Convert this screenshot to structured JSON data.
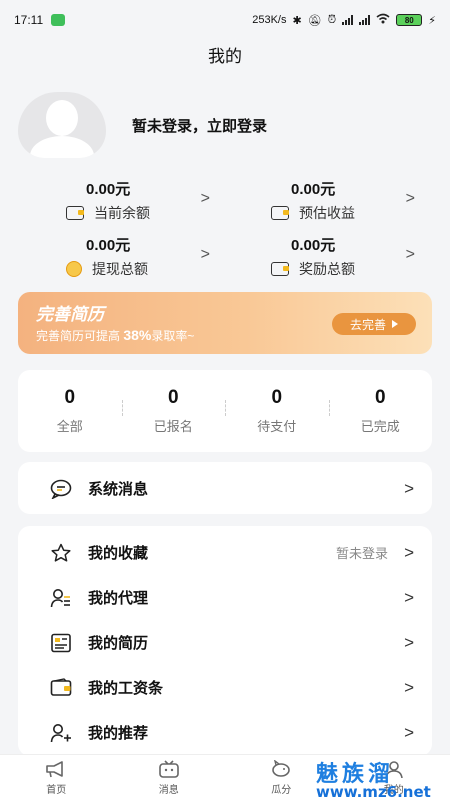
{
  "status_bar": {
    "time": "17:11",
    "network_speed": "253K/s",
    "battery": "80"
  },
  "header": {
    "title": "我的"
  },
  "profile": {
    "login_text": "暂未登录，立即登录"
  },
  "stats": [
    {
      "value": "0.00元",
      "label": "当前余额",
      "icon": "wallet-icon"
    },
    {
      "value": "0.00元",
      "label": "预估收益",
      "icon": "coin-stack-icon"
    },
    {
      "value": "0.00元",
      "label": "提现总额",
      "icon": "yuan-coin-icon"
    },
    {
      "value": "0.00元",
      "label": "奖励总额",
      "icon": "reward-icon"
    }
  ],
  "resume_banner": {
    "title": "完善简历",
    "subtitle_prefix": "完善简历可提高",
    "subtitle_percent": "38%",
    "subtitle_suffix": "录取率~",
    "button_label": "去完善"
  },
  "orders": [
    {
      "count": "0",
      "label": "全部"
    },
    {
      "count": "0",
      "label": "已报名"
    },
    {
      "count": "0",
      "label": "待支付"
    },
    {
      "count": "0",
      "label": "已完成"
    }
  ],
  "messages": {
    "label": "系统消息",
    "icon": "message-icon"
  },
  "menu": [
    {
      "label": "我的收藏",
      "value": "暂未登录",
      "icon": "star-icon"
    },
    {
      "label": "我的代理",
      "value": "",
      "icon": "user-list-icon"
    },
    {
      "label": "我的简历",
      "value": "",
      "icon": "resume-icon"
    },
    {
      "label": "我的工资条",
      "value": "",
      "icon": "wallet-icon"
    },
    {
      "label": "我的推荐",
      "value": "",
      "icon": "user-plus-icon"
    }
  ],
  "tabbar": [
    {
      "label": "首页",
      "icon": "megaphone-icon"
    },
    {
      "label": "消息",
      "icon": "tv-icon"
    },
    {
      "label": "瓜分",
      "icon": "pig-icon"
    },
    {
      "label": "我的",
      "icon": "user-icon"
    }
  ],
  "watermark": {
    "text": "魅族溜",
    "url": "www.mz6.net"
  },
  "colors": {
    "accent_orange": "#e9953f",
    "banner_start": "#f4b27f",
    "banner_end": "#fce0b8",
    "icon_yellow": "#f2b91e"
  }
}
